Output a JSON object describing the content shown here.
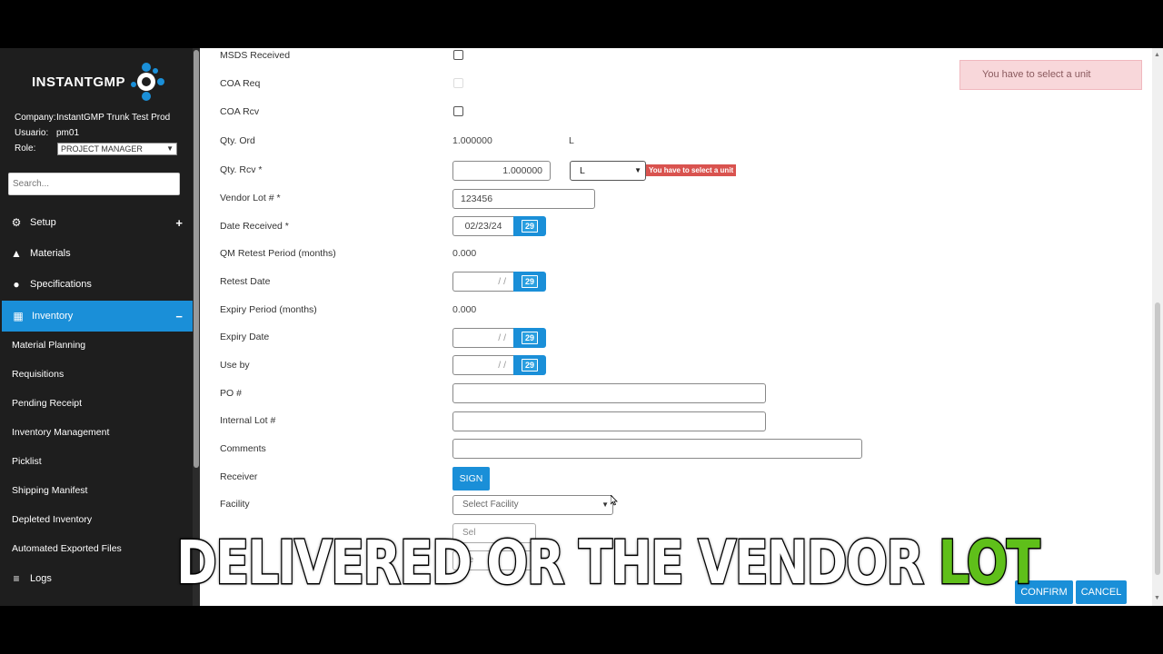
{
  "sidebar": {
    "logo_text": "INSTANTGMP",
    "company_label": "Company:",
    "company_value": "InstantGMP Trunk Test Prod",
    "user_label": "Usuario:",
    "user_value": "pm01",
    "role_label": "Role:",
    "role_value": "PROJECT MANAGER",
    "search_placeholder": "Search...",
    "nav": [
      {
        "label": "Setup",
        "icon": "gear-icon",
        "suffix": "+"
      },
      {
        "label": "Materials",
        "icon": "cubes-icon",
        "suffix": ""
      },
      {
        "label": "Specifications",
        "icon": "pills-icon",
        "suffix": ""
      },
      {
        "label": "Inventory",
        "icon": "warehouse-icon",
        "suffix": "−"
      }
    ],
    "sub_items": [
      "Material Planning",
      "Requisitions",
      "Pending Receipt",
      "Inventory Management",
      "Picklist",
      "Shipping Manifest",
      "Depleted Inventory",
      "Automated Exported Files"
    ],
    "logs_label": "Logs"
  },
  "form": {
    "msds_label": "MSDS Received",
    "coa_req_label": "COA Req",
    "coa_rcv_label": "COA Rcv",
    "qty_ord_label": "Qty. Ord",
    "qty_ord_value": "1.000000",
    "qty_ord_unit": "L",
    "qty_rcv_label": "Qty. Rcv *",
    "qty_rcv_value": "1.000000",
    "unit_value": "L",
    "unit_error": "You have to select a unit",
    "vendor_lot_label": "Vendor Lot # *",
    "vendor_lot_value": "123456",
    "date_received_label": "Date Received *",
    "date_received_value": "02/23/24",
    "qm_retest_label": "QM Retest Period (months)",
    "qm_retest_value": "0.000",
    "retest_date_label": "Retest Date",
    "expiry_period_label": "Expiry Period (months)",
    "expiry_period_value": "0.000",
    "expiry_date_label": "Expiry Date",
    "use_by_label": "Use by",
    "po_label": "PO #",
    "internal_lot_label": "Internal Lot #",
    "comments_label": "Comments",
    "receiver_label": "Receiver",
    "sign_label": "SIGN",
    "facility_label": "Facility",
    "facility_placeholder": "Select Facility",
    "empty_date": "/ /",
    "calendar_day": "29",
    "partial_select_1": "Sel",
    "partial_select_2": "Se"
  },
  "toast": {
    "message": "You have to select a unit"
  },
  "actions": {
    "confirm": "CONFIRM",
    "cancel": "CANCEL"
  },
  "caption": {
    "main": "DELIVERED OR THE VENDOR ",
    "highlight": "LOT"
  },
  "colors": {
    "accent": "#1a8fd8",
    "sidebar_bg": "#1e1e1e",
    "error": "#d9534f",
    "toast_bg": "#f8d7da",
    "caption_highlight": "#5fbf1a"
  }
}
